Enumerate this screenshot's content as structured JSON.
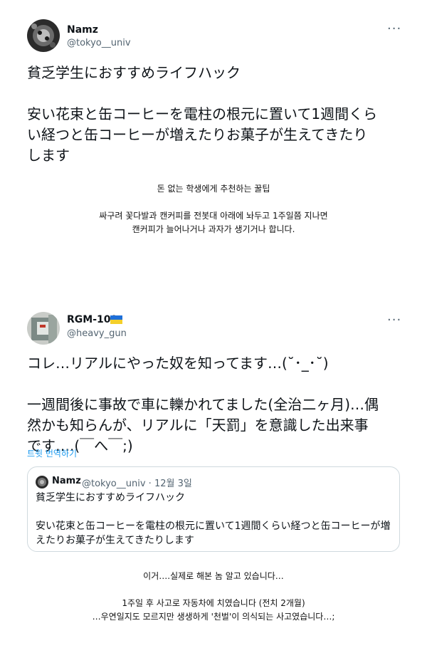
{
  "tweet1": {
    "name": "Namz",
    "handle": "@tokyo__univ",
    "more": "···",
    "text": "貧乏学生におすすめライフハック\n\n安い花束と缶コーヒーを電柱の根元に置いて1週間くら\nい経つと缶コーヒーが増えたりお菓子が生えてきたり\nします",
    "translation": "돈 없는 학생에게 추천하는 꿀팁\n\n싸구려 꽃다발과 캔커피를 전봇대 아래에 놔두고 1주일쯤 지나면\n캔커피가 늘어나거나 과자가 생기거나 합니다."
  },
  "tweet2": {
    "name": "RGM-109",
    "flag": "ukraine-flag",
    "handle": "@heavy_gun",
    "more": "···",
    "text": "コレ…リアルにやった奴を知ってます…(˘･_･˘)\n\n一週間後に事故で車に轢かれてました(全治二ヶ月)…偶\n然かも知らんが、リアルに「天罰」を意識した出来事\nです….(￣へ￣;)",
    "translate_link": "트윗 번역하기",
    "quote": {
      "name": "Namz",
      "meta": "@tokyo__univ · 12월 3일",
      "text": "貧乏学生におすすめライフハック\n\n安い花束と缶コーヒーを電柱の根元に置いて1週間くらい経つと缶コーヒーが増\nえたりお菓子が生えてきたりします"
    },
    "translation": "이거….실제로 해본 놈 알고 있습니다…\n\n1주일 후 사고로 자동차에 치였습니다 (전치 2개월)\n…우연일지도 모르지만 생생하게 '천벌'이 의식되는 사고였습니다…;"
  },
  "colors": {
    "link": "#1d9bf0",
    "secondary_text": "#536471",
    "border": "#cfd9de"
  }
}
